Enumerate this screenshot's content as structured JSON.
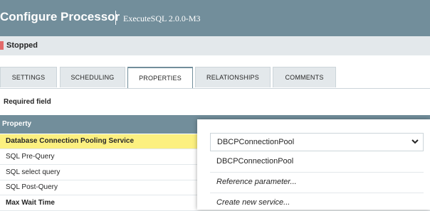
{
  "header": {
    "title": "Configure Processor",
    "subtitle": "ExecuteSQL 2.0.0-M3"
  },
  "status": {
    "text": "Stopped",
    "color": "#e26a6a"
  },
  "tabs": [
    {
      "label": "SETTINGS",
      "active": false
    },
    {
      "label": "SCHEDULING",
      "active": false
    },
    {
      "label": "PROPERTIES",
      "active": true
    },
    {
      "label": "RELATIONSHIPS",
      "active": false
    },
    {
      "label": "COMMENTS",
      "active": false
    }
  ],
  "required_field": "Required field",
  "table": {
    "header": "Property",
    "rows": [
      {
        "name": "Database Connection Pooling Service",
        "required": true,
        "selected": true
      },
      {
        "name": "SQL Pre-Query",
        "required": false
      },
      {
        "name": "SQL select query",
        "required": false
      },
      {
        "name": "SQL Post-Query",
        "required": false,
        "help_icon": "help-icon"
      },
      {
        "name": "Max Wait Time",
        "required": true,
        "help_icon": "help-icon"
      }
    ]
  },
  "dropdown": {
    "selected": "DBCPConnectionPool",
    "options": [
      "DBCPConnectionPool",
      "Reference parameter...",
      "Create new service..."
    ]
  },
  "colors": {
    "accent": "#728e9b",
    "selected_row": "#fcf080",
    "status_bar": "#e3e8eb"
  }
}
